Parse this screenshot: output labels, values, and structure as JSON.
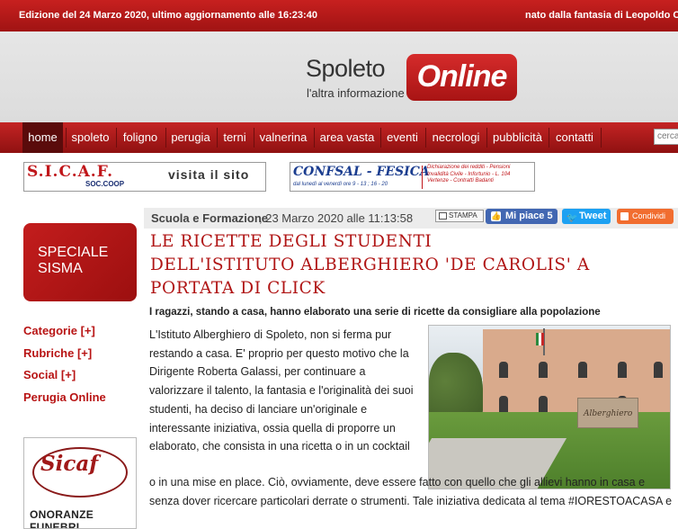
{
  "topbar": {
    "edition": "Edizione del 24 Marzo 2020, ultimo aggiornamento alle 16:23:40",
    "credits": "nato dalla fantasia di Leopoldo Cori"
  },
  "logo": {
    "brand": "Spoleto",
    "online": "Online",
    "tagline": "l'altra informazione"
  },
  "nav": {
    "items": [
      "home",
      "spoleto",
      "foligno",
      "perugia",
      "terni",
      "valnerina",
      "area vasta",
      "eventi",
      "necrologi",
      "pubblicità",
      "contatti"
    ],
    "active": "home",
    "search_placeholder": "cerca"
  },
  "banners": {
    "sicaf": {
      "name": "S.I.C.A.F.",
      "sub": "SOC.COOP",
      "cta": "visita il sito"
    },
    "confsal": {
      "name": "CONFSAL - FESICA",
      "hours": "dal lunedì al venerdì ore 9 - 13 ; 16 - 20",
      "services": [
        "Dichiarazione dei redditi - Pensioni",
        "Invalidità Civile - Infortunio - L. 104",
        "Vertenze - Contratti Badanti"
      ]
    }
  },
  "sidebar": {
    "speciale_line1": "SPECIALE",
    "speciale_line2": "SISMA",
    "links": [
      "Categorie [+]",
      "Rubriche [+]",
      "Social [+]",
      "Perugia Online"
    ],
    "ad": {
      "logo_text": "Sicaf",
      "caption": "ONORANZE FUNEBRI"
    }
  },
  "article": {
    "category": "Scuola e Formazione",
    "date": ", 23 Marzo 2020 alle 11:13:58",
    "actions": {
      "print": "STAMPA",
      "like": "Mi piace 5",
      "tweet": "Tweet",
      "share": "Condividi"
    },
    "headline_lines": [
      "LE RICETTE DEGLI STUDENTI",
      "DELL'ISTITUTO ALBERGHIERO 'DE CAROLIS' A",
      "PORTATA DI CLICK"
    ],
    "subtitle": "I ragazzi, stando a casa, hanno elaborato una serie di ricette da consigliare alla popolazione",
    "body_part1": "L'Istituto Alberghiero di Spoleto, non si ferma pur restando a casa. E' proprio per questo motivo che la Dirigente Roberta Galassi, per continuare a valorizzare il talento, la fantasia e l'originalità dei suoi studenti, ha deciso di lanciare un'originale e interessante iniziativa, ossia quella di proporre un elaborato, che consista in una ricetta o in un cocktail",
    "body_part2": "o in una mise en place. Ciò, ovviamente, deve essere fatto con quello che gli allievi hanno in casa e senza dover ricercare particolari derrate o strumenti. Tale iniziativa dedicata al tema #IORESTOACASA e",
    "photo_sign": "Alberghiero"
  },
  "colors": {
    "brand_red": "#b81414",
    "nav_active": "#5a0b0b",
    "facebook": "#4267b2",
    "twitter": "#1da1f2",
    "share": "#f16d2f"
  }
}
